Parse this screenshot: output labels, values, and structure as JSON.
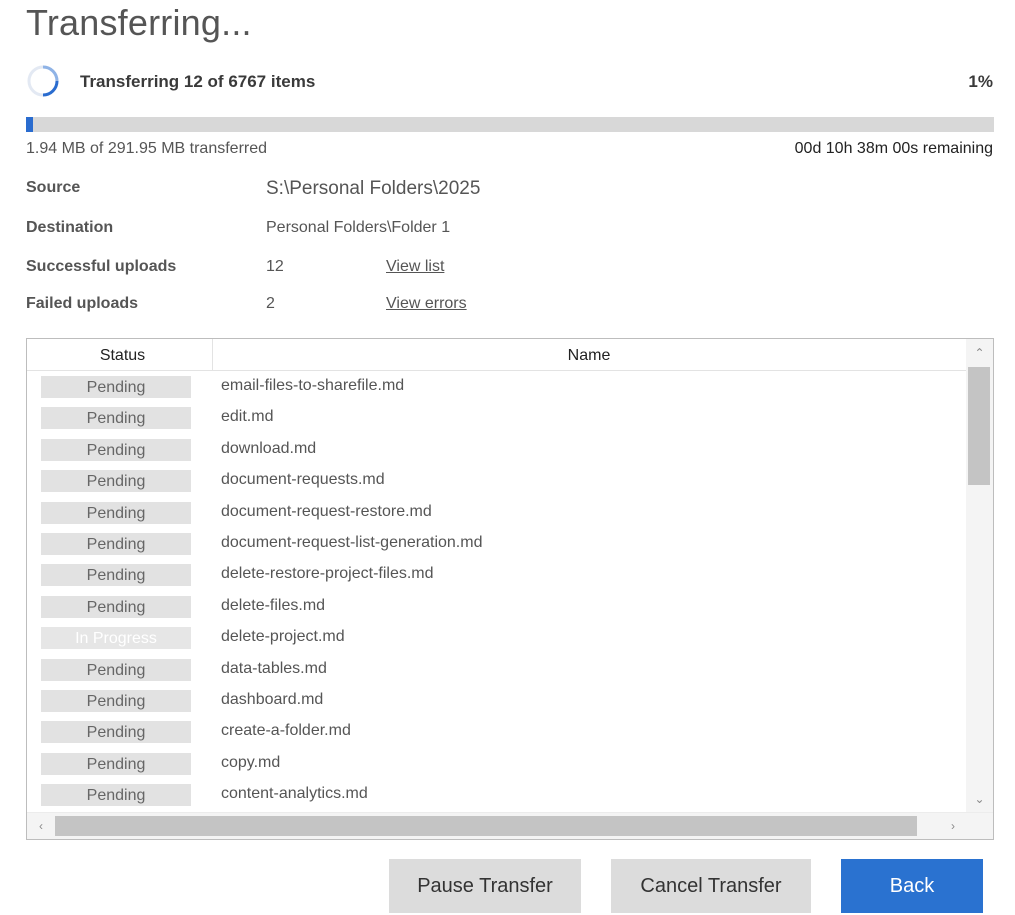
{
  "title": "Transferring...",
  "status": {
    "summary": "Transferring 12 of 6767 items",
    "percent_label": "1%",
    "progress_fraction": 0.007,
    "transferred": "1.94 MB of 291.95 MB transferred",
    "remaining": "00d 10h 38m 00s remaining"
  },
  "info": {
    "source_label": "Source",
    "source_value": "S:\\Personal Folders\\2025",
    "destination_label": "Destination",
    "destination_value": "Personal Folders\\Folder 1",
    "success_label": "Successful uploads",
    "success_count": "12",
    "success_link": "View list",
    "failed_label": "Failed uploads",
    "failed_count": "2",
    "failed_link": "View errors"
  },
  "table": {
    "columns": [
      "Status",
      "Name"
    ],
    "rows": [
      {
        "status": "Pending",
        "name": "email-files-to-sharefile.md"
      },
      {
        "status": "Pending",
        "name": "edit.md"
      },
      {
        "status": "Pending",
        "name": "download.md"
      },
      {
        "status": "Pending",
        "name": "document-requests.md"
      },
      {
        "status": "Pending",
        "name": "document-request-restore.md"
      },
      {
        "status": "Pending",
        "name": "document-request-list-generation.md"
      },
      {
        "status": "Pending",
        "name": "delete-restore-project-files.md"
      },
      {
        "status": "Pending",
        "name": "delete-files.md"
      },
      {
        "status": "In Progress",
        "name": "delete-project.md"
      },
      {
        "status": "Pending",
        "name": "data-tables.md"
      },
      {
        "status": "Pending",
        "name": "dashboard.md"
      },
      {
        "status": "Pending",
        "name": "create-a-folder.md"
      },
      {
        "status": "Pending",
        "name": "copy.md"
      },
      {
        "status": "Pending",
        "name": "content-analytics.md"
      }
    ]
  },
  "buttons": {
    "pause": "Pause Transfer",
    "cancel": "Cancel Transfer",
    "back": "Back"
  },
  "icons": {
    "spinner": "loading-spinner-icon",
    "scroll_up": "chevron-up-icon",
    "scroll_down": "chevron-down-icon",
    "scroll_left": "chevron-left-icon",
    "scroll_right": "chevron-right-icon"
  },
  "colors": {
    "accent": "#2a72d0",
    "progress_fill": "#2a6ccf",
    "track": "#d8d8d8"
  }
}
